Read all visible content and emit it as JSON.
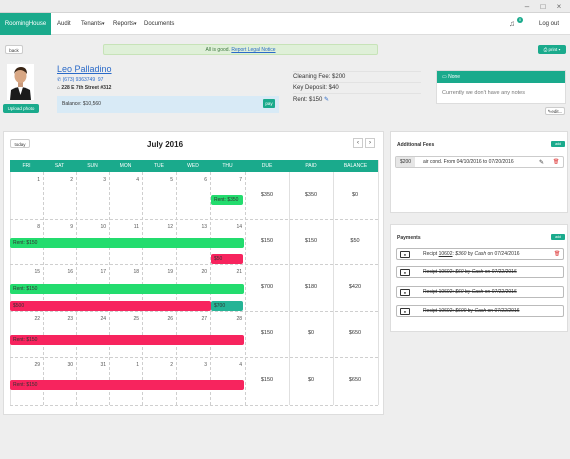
{
  "app": {
    "brand": "RoomingHouse"
  },
  "nav": {
    "items": [
      {
        "label": "Audit"
      },
      {
        "label": "Tenants"
      },
      {
        "label": "Reports"
      },
      {
        "label": "Documents"
      }
    ],
    "notification_count": "0",
    "logout_label": "Log out"
  },
  "toolbar": {
    "back_label": "back",
    "print_label": "print"
  },
  "alert": {
    "text": "All is good.",
    "link_text": "Report Legal Notice"
  },
  "tenant": {
    "name": "Leo Palladino",
    "phone": "(673) 9363749 97",
    "address": "228 E 7th Street #312",
    "upload_label": "Upload photo",
    "balance_text": "Balance: $10,560",
    "pay_label": "pay"
  },
  "fees_summary": {
    "cleaning": "Cleaning Fee: $200",
    "deposit": "Key Deposit: $40",
    "rent": "Rent: $150"
  },
  "notes": {
    "header": "None",
    "empty_text": "Currently we don't have any notes",
    "edit_label": "edit..."
  },
  "calendar": {
    "today_label": "today",
    "month_title": "July 2016",
    "prev_label": "‹",
    "next_label": "›",
    "day_headers": [
      "FRI",
      "SAT",
      "SUN",
      "MON",
      "TUE",
      "WED",
      "THU"
    ],
    "summary_headers": [
      "DUE",
      "PAID",
      "BALANCE"
    ],
    "weeks": [
      {
        "days": [
          "1",
          "2",
          "3",
          "4",
          "5",
          "6",
          "7"
        ],
        "due": "$350",
        "paid": "$350",
        "balance": "$0"
      },
      {
        "days": [
          "8",
          "9",
          "10",
          "11",
          "12",
          "13",
          "14"
        ],
        "due": "$150",
        "paid": "$150",
        "balance": "$50"
      },
      {
        "days": [
          "15",
          "16",
          "17",
          "18",
          "19",
          "20",
          "21"
        ],
        "due": "$700",
        "paid": "$180",
        "balance": "$420"
      },
      {
        "days": [
          "22",
          "23",
          "24",
          "25",
          "26",
          "27",
          "28"
        ],
        "due": "$150",
        "paid": "$0",
        "balance": "$650"
      },
      {
        "days": [
          "29",
          "30",
          "31",
          "1",
          "2",
          "3",
          "4"
        ],
        "due": "$150",
        "paid": "$0",
        "balance": "$650"
      }
    ],
    "events": {
      "w1_rent": "Rent: $350",
      "w2_rent": "Rent: $150",
      "w2_fee": "$50",
      "w3_rent": "Rent: $150",
      "w3_fee": "$500",
      "w3_fee2": "$700",
      "w4_rent": "Rent: $150",
      "w5_rent": "Rent: $150"
    }
  },
  "additional_fees": {
    "title": "Additional Fees",
    "add_label": "add",
    "items": [
      {
        "amount": "$200",
        "text": "air cond. From 04/10/2016 to 07/20/2016"
      }
    ]
  },
  "payments": {
    "title": "Payments",
    "add_label": "add",
    "items": [
      {
        "receipt": "Recipt",
        "num": "10602",
        "amount": "$360",
        "method": "Cash",
        "date": "on 07/24/2016"
      },
      {
        "receipt": "Recipt",
        "num": "10602",
        "amount": "$60",
        "method": "Cash",
        "date": "on 07/22/2016"
      },
      {
        "receipt": "Recipt",
        "num": "10602",
        "amount": "$60",
        "method": "Cash",
        "date": "on 07/22/2016"
      },
      {
        "receipt": "Recipt",
        "num": "10602",
        "amount": "$600",
        "method": "Cash",
        "date": "on 07/22/2016"
      }
    ]
  },
  "colors": {
    "accent": "#1aaa8c",
    "rent": "#23dc6e",
    "fee": "#f7245e"
  },
  "icons": [
    "phone-icon",
    "home-icon",
    "printer-icon",
    "pencil-icon",
    "trash-icon",
    "bill-icon",
    "bell-icon",
    "comment-icon"
  ]
}
